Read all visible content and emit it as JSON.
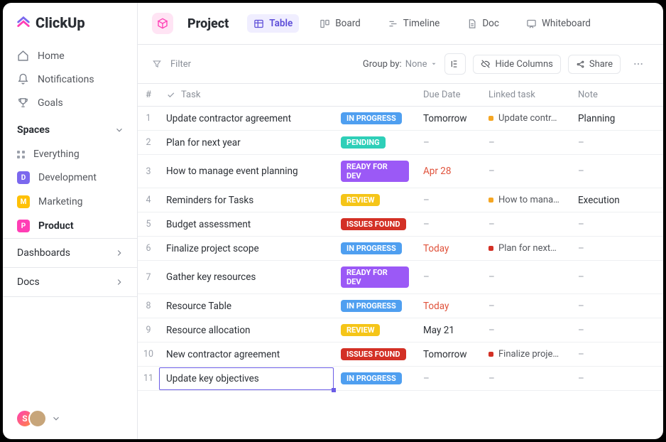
{
  "brand": "ClickUp",
  "nav": {
    "home": "Home",
    "notifications": "Notifications",
    "goals": "Goals"
  },
  "spaces": {
    "header": "Spaces",
    "everything": "Everything",
    "items": [
      {
        "letter": "D",
        "label": "Development",
        "color": "#7b68ee"
      },
      {
        "letter": "M",
        "label": "Marketing",
        "color": "#ffc107"
      },
      {
        "letter": "P",
        "label": "Product",
        "color": "#ff3eb5",
        "active": true
      }
    ]
  },
  "sections": {
    "dashboards": "Dashboards",
    "docs": "Docs"
  },
  "header": {
    "title": "Project",
    "views": {
      "table": "Table",
      "board": "Board",
      "timeline": "Timeline",
      "doc": "Doc",
      "whiteboard": "Whiteboard"
    }
  },
  "toolbar": {
    "filter": "Filter",
    "groupby_label": "Group by:",
    "groupby_value": "None",
    "hide_columns": "Hide Columns",
    "share": "Share"
  },
  "columns": {
    "num": "#",
    "task": "Task",
    "due": "Due Date",
    "linked": "Linked task",
    "note": "Note"
  },
  "statuses": {
    "in_progress": {
      "label": "IN PROGRESS",
      "color": "#4f9ff0"
    },
    "pending": {
      "label": "PENDING",
      "color": "#2ecfb8"
    },
    "ready_for_dev": {
      "label": "READY FOR DEV",
      "color": "#9b59f6"
    },
    "review": {
      "label": "REVIEW",
      "color": "#f5c518"
    },
    "issues_found": {
      "label": "ISSUES FOUND",
      "color": "#d33025"
    }
  },
  "rows": [
    {
      "n": "1",
      "task": "Update contractor agreement",
      "status": "in_progress",
      "due": "Tomorrow",
      "due_class": "",
      "linked": "Update contr…",
      "linked_color": "#f5a623",
      "note": "Planning"
    },
    {
      "n": "2",
      "task": "Plan for next year",
      "status": "pending",
      "due": "–",
      "due_class": "dash",
      "linked": "–",
      "note": "–"
    },
    {
      "n": "3",
      "task": "How to manage event planning",
      "status": "ready_for_dev",
      "due": "Apr 28",
      "due_class": "due-red",
      "linked": "–",
      "note": "–"
    },
    {
      "n": "4",
      "task": "Reminders for Tasks",
      "status": "review",
      "due": "–",
      "due_class": "dash",
      "linked": "How to mana…",
      "linked_color": "#f5a623",
      "note": "Execution"
    },
    {
      "n": "5",
      "task": "Budget assessment",
      "status": "issues_found",
      "due": "–",
      "due_class": "dash",
      "linked": "–",
      "note": "–"
    },
    {
      "n": "6",
      "task": "Finalize project scope",
      "status": "in_progress",
      "due": "Today",
      "due_class": "due-red",
      "linked": "Plan for next…",
      "linked_color": "#d33025",
      "note": "–"
    },
    {
      "n": "7",
      "task": "Gather key resources",
      "status": "ready_for_dev",
      "due": "–",
      "due_class": "dash",
      "linked": "–",
      "note": "–"
    },
    {
      "n": "8",
      "task": "Resource Table",
      "status": "in_progress",
      "due": "Today",
      "due_class": "due-red",
      "linked": "–",
      "note": "–"
    },
    {
      "n": "9",
      "task": "Resource allocation",
      "status": "review",
      "due": "May 21",
      "due_class": "",
      "linked": "–",
      "note": "–"
    },
    {
      "n": "10",
      "task": "New contractor agreement",
      "status": "issues_found",
      "due": "Tomorrow",
      "due_class": "",
      "linked": "Finalize proje…",
      "linked_color": "#d33025",
      "note": "–"
    },
    {
      "n": "11",
      "task": "Update key objectives",
      "status": "in_progress",
      "due": "–",
      "due_class": "dash",
      "linked": "–",
      "note": "–",
      "editing": true
    }
  ],
  "avatars": [
    {
      "letter": "S",
      "bg": "linear-gradient(135deg,#ff3eb5,#ff8a3e)"
    },
    {
      "letter": "",
      "bg": "#c7a57a"
    }
  ]
}
